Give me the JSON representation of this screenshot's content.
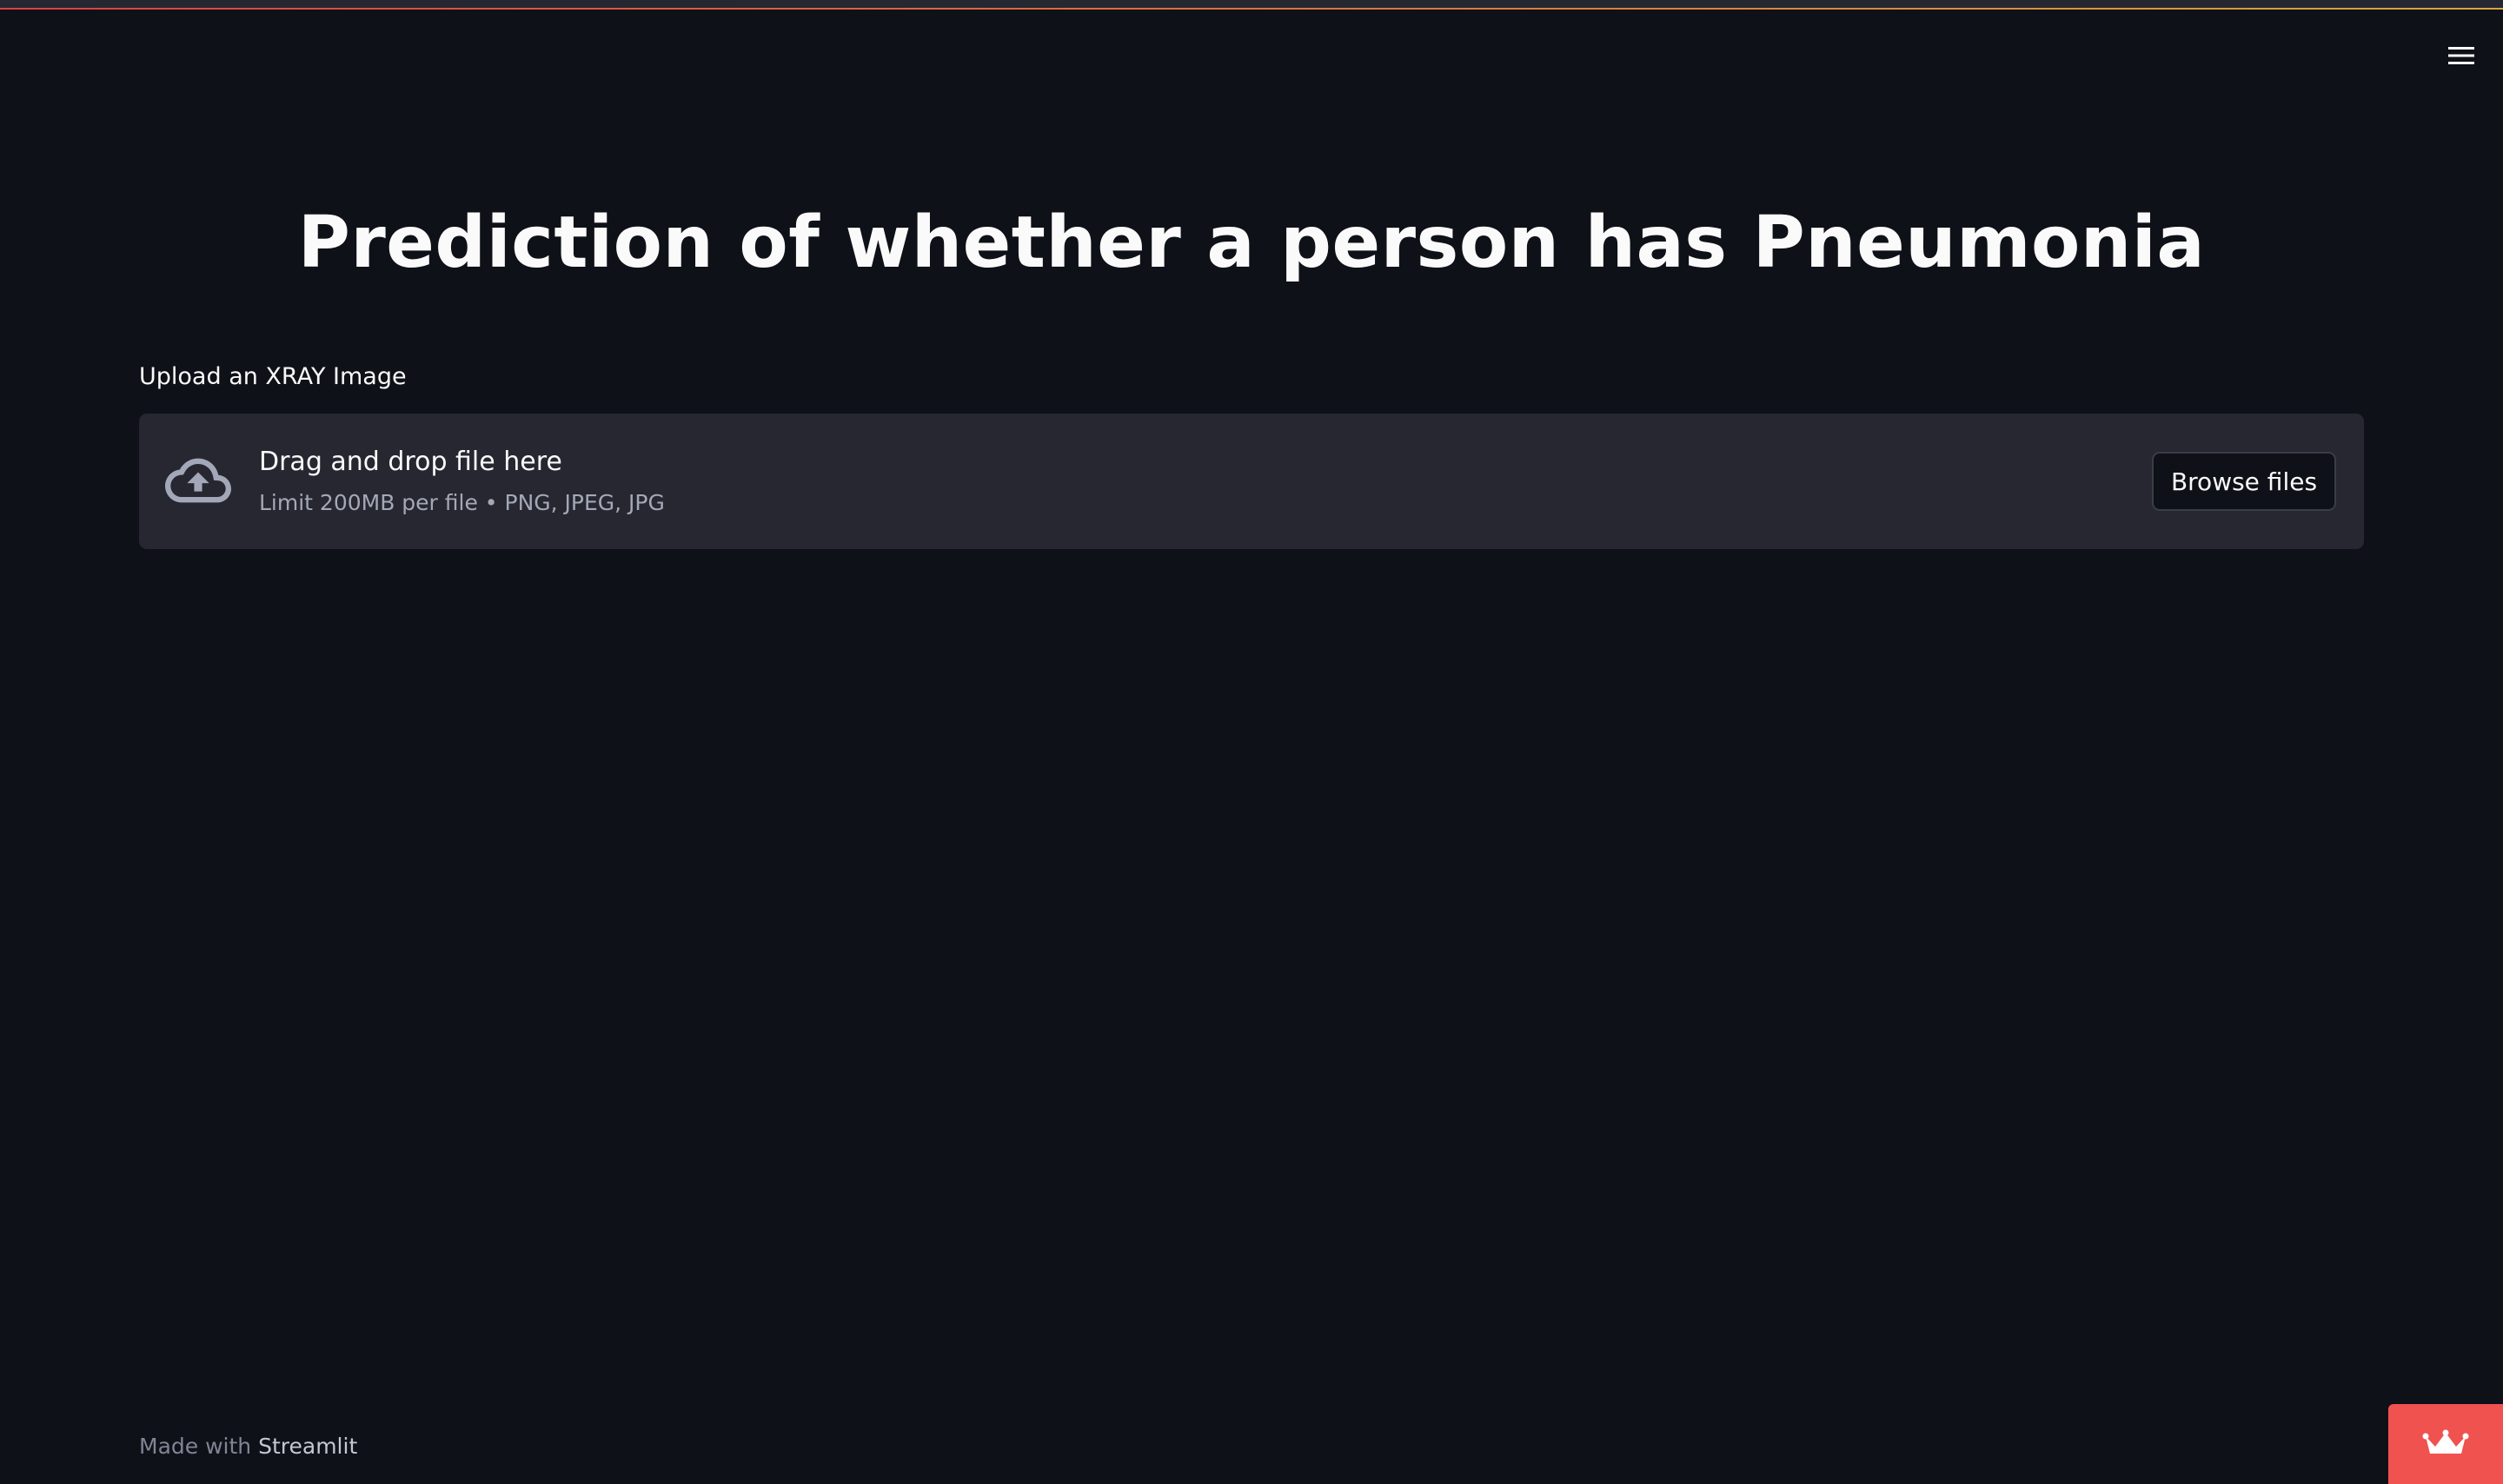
{
  "app": {
    "title": "Prediction of whether a person has Pneumonia"
  },
  "uploader": {
    "label": "Upload an XRAY Image",
    "drag_text": "Drag and drop file here",
    "limit_text": "Limit 200MB per file • PNG, JPEG, JPG",
    "browse_label": "Browse files"
  },
  "footer": {
    "prefix": "Made with",
    "brand": "Streamlit"
  },
  "icons": {
    "menu": "hamburger-menu-icon",
    "upload": "cloud-upload-icon",
    "badge": "crown-icon"
  },
  "colors": {
    "background": "#0e1117",
    "surface": "#262730",
    "text": "#fafafa",
    "muted": "#a3a8b8",
    "accent": "#ff4b4b",
    "badge": "#f0524f"
  }
}
